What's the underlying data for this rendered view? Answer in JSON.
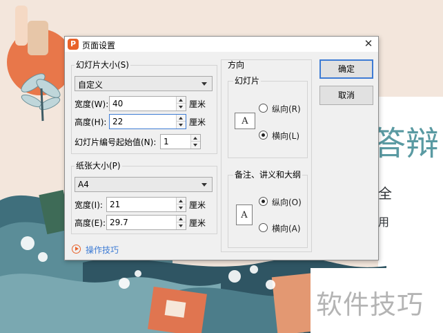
{
  "dialog": {
    "title": "页面设置",
    "close_glyph": "✕",
    "app_icon_letter": "P"
  },
  "slide_size": {
    "group_label": "幻灯片大小(S)",
    "selected": "自定义",
    "width_label": "宽度(W):",
    "width_value": "40",
    "width_unit": "厘米",
    "height_label": "高度(H):",
    "height_value": "22",
    "height_unit": "厘米",
    "start_number_label": "幻灯片编号起始值(N):",
    "start_number_value": "1"
  },
  "paper_size": {
    "group_label": "纸张大小(P)",
    "selected": "A4",
    "width_label": "宽度(I):",
    "width_value": "21",
    "width_unit": "厘米",
    "height_label": "高度(E):",
    "height_value": "29.7",
    "height_unit": "厘米"
  },
  "orientation": {
    "section_label": "方向",
    "slides": {
      "group_label": "幻灯片",
      "icon_letter": "A",
      "portrait_label": "纵向(R)",
      "landscape_label": "横向(L)",
      "selected": "landscape"
    },
    "notes": {
      "group_label": "备注、讲义和大纲",
      "icon_letter": "A",
      "portrait_label": "纵向(O)",
      "landscape_label": "横向(A)",
      "selected": "portrait"
    }
  },
  "buttons": {
    "ok_label": "确定",
    "cancel_label": "取消"
  },
  "tips_link": "操作技巧",
  "background": {
    "title_fragment": "答辩",
    "sub_line1": "全",
    "sub_line2": "用",
    "watermark": "软件技巧"
  },
  "colors": {
    "accent_blue": "#3d7bd4",
    "brand_orange": "#e8622a",
    "slide_teal": "#5a9aa2"
  }
}
